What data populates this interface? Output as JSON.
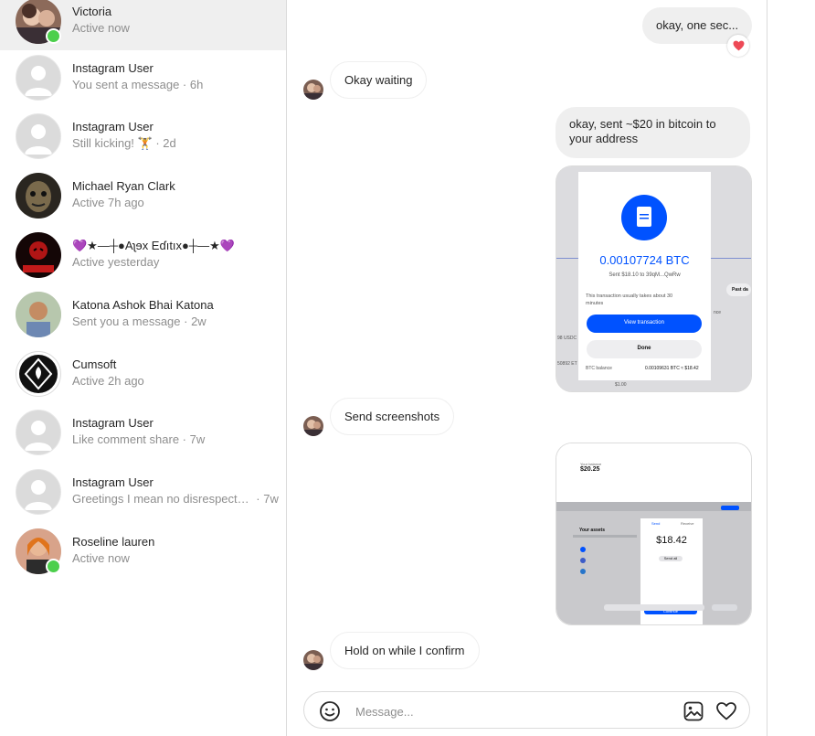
{
  "conversations": [
    {
      "name": "Victoria",
      "status": "Active now",
      "online": true,
      "selected": true
    },
    {
      "name": "Instagram User",
      "status": "You sent a message · 6h",
      "online": false
    },
    {
      "name": "Instagram User",
      "status": "Still kicking! 🏋 · 2d",
      "online": false
    },
    {
      "name": "Michael Ryan Clark",
      "status": "Active 7h ago",
      "online": false
    },
    {
      "name": "💜★—┼●Aʅɘx Eɗıtıx●┼—★💜",
      "status": "Active yesterday",
      "online": false
    },
    {
      "name": "Katona Ashok Bhai Katona",
      "status": "Sent you a message · 2w",
      "online": false
    },
    {
      "name": "Cumsoft",
      "status": "Active 2h ago",
      "online": false
    },
    {
      "name": "Instagram User",
      "status": "Like comment share · 7w",
      "online": false
    },
    {
      "name": "Instagram User",
      "status": "Greetings I mean no disrespect…",
      "time": "· 7w",
      "online": false
    },
    {
      "name": "Roseline lauren",
      "status": "Active now",
      "online": true
    }
  ],
  "messages": {
    "m1": "okay, one sec...",
    "m1_reaction": "heart",
    "m2": "Okay waiting",
    "m3_line1": "okay, sent ~$20 in bitcoin to",
    "m3_line2": "your address",
    "m4": "Send screenshots",
    "m5": "Hold on while I confirm"
  },
  "screenshot1": {
    "amount": "0.00107724 BTC",
    "sent_line": "Sent $18.10 to 39qM...QwRw",
    "note_line1": "This transaction usually takes about 30",
    "note_line2": "minutes",
    "view_button": "View transaction",
    "done_button": "Done",
    "balance_label": "BTC balance",
    "balance_value": "0.00109631 BTC ≈ $18.42",
    "bottom_value": "$1.00",
    "side_label": "Past da",
    "side_usdc": "98 USDC",
    "side_eth": "50892 ET",
    "side_nce": "nce"
  },
  "screenshot2": {
    "balance_label": "Your balance",
    "balance": "$20.25",
    "assets_title": "Your assets",
    "send_tab": "Send",
    "receive_tab": "Receive",
    "amount": "$18.42",
    "max_label": "Send all",
    "continue_button": "Continue"
  },
  "composer": {
    "placeholder": "Message...",
    "emoji_icon": "smile-icon",
    "image_icon": "image-icon",
    "like_icon": "heart-icon"
  },
  "colors": {
    "online": "#4ccf4c",
    "reaction": "#ed4956",
    "coinbase_blue": "#0052ff",
    "selected_row": "#efefef"
  }
}
